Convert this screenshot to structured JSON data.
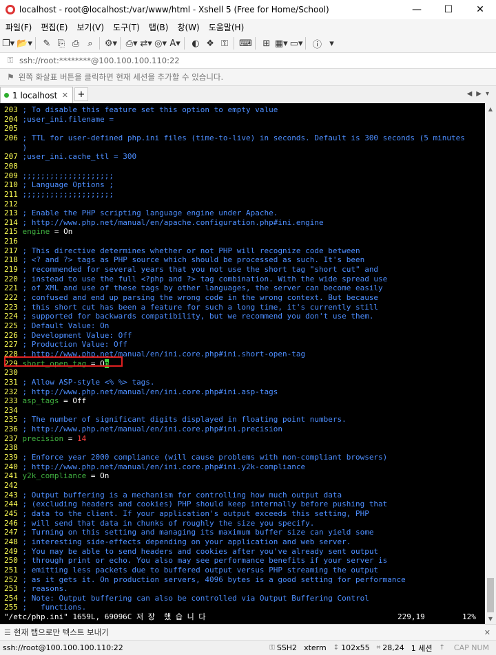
{
  "window": {
    "title": "localhost - root@localhost:/var/www/html - Xshell 5 (Free for Home/School)",
    "minimize_icon": "minimize-icon",
    "maximize_icon": "maximize-icon",
    "close_icon": "close-icon"
  },
  "menu": [
    "파일(F)",
    "편집(E)",
    "보기(V)",
    "도구(T)",
    "탭(B)",
    "창(W)",
    "도움말(H)"
  ],
  "toolbar": {
    "icons": [
      "new-session-icon",
      "open-folder-icon",
      "edit-icon",
      "copy-icon",
      "paste-icon",
      "find-icon",
      "properties-icon",
      "print-icon",
      "transfer-icon",
      "globe-icon",
      "font-icon",
      "xftp-icon",
      "xmanager-icon",
      "lock-icon",
      "keyboard-icon",
      "compose-icon",
      "layout-icon",
      "help-icon"
    ]
  },
  "address": {
    "text": "ssh://root:********@100.100.100.110:22"
  },
  "hint": {
    "text": "왼쪽 화살표 버튼을 클릭하면 현재 세션을 추가할 수 있습니다."
  },
  "tabs": [
    {
      "number": "1",
      "label": "localhost"
    }
  ],
  "terminal": {
    "lines": [
      {
        "n": "203",
        "parts": [
          {
            "t": "; To disable this feature set this option to empty value",
            "c": "c-comment"
          }
        ]
      },
      {
        "n": "204",
        "parts": [
          {
            "t": ";user_ini.filename =",
            "c": "c-comment"
          }
        ]
      },
      {
        "n": "205",
        "parts": []
      },
      {
        "n": "206",
        "parts": [
          {
            "t": "; TTL for user-defined php.ini files (time-to-live) in seconds. Default is 300 seconds (5 minutes",
            "c": "c-comment"
          }
        ]
      },
      {
        "n": "",
        "parts": [
          {
            "t": ")",
            "c": "c-comment"
          }
        ]
      },
      {
        "n": "207",
        "parts": [
          {
            "t": ";user_ini.cache_ttl = 300",
            "c": "c-comment"
          }
        ]
      },
      {
        "n": "208",
        "parts": []
      },
      {
        "n": "209",
        "parts": [
          {
            "t": ";;;;;;;;;;;;;;;;;;;;",
            "c": "c-comment"
          }
        ]
      },
      {
        "n": "210",
        "parts": [
          {
            "t": "; Language Options ;",
            "c": "c-comment"
          }
        ]
      },
      {
        "n": "211",
        "parts": [
          {
            "t": ";;;;;;;;;;;;;;;;;;;;",
            "c": "c-comment"
          }
        ]
      },
      {
        "n": "212",
        "parts": []
      },
      {
        "n": "213",
        "parts": [
          {
            "t": "; Enable the PHP scripting language engine under Apache.",
            "c": "c-comment"
          }
        ]
      },
      {
        "n": "214",
        "parts": [
          {
            "t": "; http://www.php.net/manual/en/apache.configuration.php#ini.engine",
            "c": "c-comment"
          }
        ]
      },
      {
        "n": "215",
        "parts": [
          {
            "t": "engine",
            "c": "c-key"
          },
          {
            "t": " = ",
            "c": "c-val"
          },
          {
            "t": "On",
            "c": "c-val"
          }
        ]
      },
      {
        "n": "216",
        "parts": []
      },
      {
        "n": "217",
        "parts": [
          {
            "t": "; This directive determines whether or not PHP will recognize code between",
            "c": "c-comment"
          }
        ]
      },
      {
        "n": "218",
        "parts": [
          {
            "t": "; <? and ?> tags as PHP source which should be processed as such. It's been",
            "c": "c-comment"
          }
        ]
      },
      {
        "n": "219",
        "parts": [
          {
            "t": "; recommended for several years that you not use the short tag \"short cut\" and",
            "c": "c-comment"
          }
        ]
      },
      {
        "n": "220",
        "parts": [
          {
            "t": "; instead to use the full <?php and ?> tag combination. With the wide spread use",
            "c": "c-comment"
          }
        ]
      },
      {
        "n": "221",
        "parts": [
          {
            "t": "; of XML and use of these tags by other languages, the server can become easily",
            "c": "c-comment"
          }
        ]
      },
      {
        "n": "222",
        "parts": [
          {
            "t": "; confused and end up parsing the wrong code in the wrong context. But because",
            "c": "c-comment"
          }
        ]
      },
      {
        "n": "223",
        "parts": [
          {
            "t": "; this short cut has been a feature for such a long time, it's currently still",
            "c": "c-comment"
          }
        ]
      },
      {
        "n": "224",
        "parts": [
          {
            "t": "; supported for backwards compatibility, but we recommend you don't use them.",
            "c": "c-comment"
          }
        ]
      },
      {
        "n": "225",
        "parts": [
          {
            "t": "; Default Value: On",
            "c": "c-comment"
          }
        ]
      },
      {
        "n": "226",
        "parts": [
          {
            "t": "; Development Value: Off",
            "c": "c-comment"
          }
        ]
      },
      {
        "n": "227",
        "parts": [
          {
            "t": "; Production Value: Off",
            "c": "c-comment"
          }
        ]
      },
      {
        "n": "228",
        "parts": [
          {
            "t": "; http://www.php.net/manual/en/ini.core.php#ini.short-open-tag",
            "c": "c-comment"
          }
        ]
      },
      {
        "n": "229",
        "parts": [
          {
            "t": "short_open_tag",
            "c": "c-key"
          },
          {
            "t": " = ",
            "c": "c-val"
          },
          {
            "t": "O",
            "c": "c-val"
          },
          {
            "t": "n",
            "c": "cursor"
          }
        ]
      },
      {
        "n": "230",
        "parts": []
      },
      {
        "n": "231",
        "parts": [
          {
            "t": "; Allow ASP-style <% %> tags.",
            "c": "c-comment"
          }
        ]
      },
      {
        "n": "232",
        "parts": [
          {
            "t": "; http://www.php.net/manual/en/ini.core.php#ini.asp-tags",
            "c": "c-comment"
          }
        ]
      },
      {
        "n": "233",
        "parts": [
          {
            "t": "asp_tags",
            "c": "c-key"
          },
          {
            "t": " = ",
            "c": "c-val"
          },
          {
            "t": "Off",
            "c": "c-val"
          }
        ]
      },
      {
        "n": "234",
        "parts": []
      },
      {
        "n": "235",
        "parts": [
          {
            "t": "; The number of significant digits displayed in floating point numbers.",
            "c": "c-comment"
          }
        ]
      },
      {
        "n": "236",
        "parts": [
          {
            "t": "; http://www.php.net/manual/en/ini.core.php#ini.precision",
            "c": "c-comment"
          }
        ]
      },
      {
        "n": "237",
        "parts": [
          {
            "t": "precision",
            "c": "c-key"
          },
          {
            "t": " = ",
            "c": "c-val"
          },
          {
            "t": "14",
            "c": "c-num"
          }
        ]
      },
      {
        "n": "238",
        "parts": []
      },
      {
        "n": "239",
        "parts": [
          {
            "t": "; Enforce year 2000 compliance (will cause problems with non-compliant browsers)",
            "c": "c-comment"
          }
        ]
      },
      {
        "n": "240",
        "parts": [
          {
            "t": "; http://www.php.net/manual/en/ini.core.php#ini.y2k-compliance",
            "c": "c-comment"
          }
        ]
      },
      {
        "n": "241",
        "parts": [
          {
            "t": "y2k_compliance",
            "c": "c-key"
          },
          {
            "t": " = ",
            "c": "c-val"
          },
          {
            "t": "On",
            "c": "c-val"
          }
        ]
      },
      {
        "n": "242",
        "parts": []
      },
      {
        "n": "243",
        "parts": [
          {
            "t": "; Output buffering is a mechanism for controlling how much output data",
            "c": "c-comment"
          }
        ]
      },
      {
        "n": "244",
        "parts": [
          {
            "t": "; (excluding headers and cookies) PHP should keep internally before pushing that",
            "c": "c-comment"
          }
        ]
      },
      {
        "n": "245",
        "parts": [
          {
            "t": "; data to the client. If your application's output exceeds this setting, PHP",
            "c": "c-comment"
          }
        ]
      },
      {
        "n": "246",
        "parts": [
          {
            "t": "; will send that data in chunks of roughly the size you specify.",
            "c": "c-comment"
          }
        ]
      },
      {
        "n": "247",
        "parts": [
          {
            "t": "; Turning on this setting and managing its maximum buffer size can yield some",
            "c": "c-comment"
          }
        ]
      },
      {
        "n": "248",
        "parts": [
          {
            "t": "; interesting side-effects depending on your application and web server.",
            "c": "c-comment"
          }
        ]
      },
      {
        "n": "249",
        "parts": [
          {
            "t": "; You may be able to send headers and cookies after you've already sent output",
            "c": "c-comment"
          }
        ]
      },
      {
        "n": "250",
        "parts": [
          {
            "t": "; through print or echo. You also may see performance benefits if your server is",
            "c": "c-comment"
          }
        ]
      },
      {
        "n": "251",
        "parts": [
          {
            "t": "; emitting less packets due to buffered output versus PHP streaming the output",
            "c": "c-comment"
          }
        ]
      },
      {
        "n": "252",
        "parts": [
          {
            "t": "; as it gets it. On production servers, 4096 bytes is a good setting for performance",
            "c": "c-comment"
          }
        ]
      },
      {
        "n": "253",
        "parts": [
          {
            "t": "; reasons.",
            "c": "c-comment"
          }
        ]
      },
      {
        "n": "254",
        "parts": [
          {
            "t": "; Note: Output buffering can also be controlled via Output Buffering Control",
            "c": "c-comment"
          }
        ]
      },
      {
        "n": "255",
        "parts": [
          {
            "t": ";   functions.",
            "c": "c-comment"
          }
        ]
      }
    ],
    "status_left": "\"/etc/php.ini\" 1659L, 69096C 저 장  했 습 니 다",
    "status_pos": "229,19",
    "status_pct": "12%"
  },
  "sendbar": {
    "text": "현재 탭으로만 텍스트 보내기"
  },
  "statusbar": {
    "connection": "ssh://root@100.100.100.110:22",
    "protocol": "SSH2",
    "term": "xterm",
    "size": "102x55",
    "cursor": "28,24",
    "sessions": "1 세션",
    "caps": "CAP NUM"
  },
  "colors": {
    "terminal_bg": "#000000",
    "comment": "#4d8eff",
    "line_number": "#ffff55",
    "key": "#40b040",
    "number": "#ff4040",
    "highlight_box": "#e02020"
  }
}
